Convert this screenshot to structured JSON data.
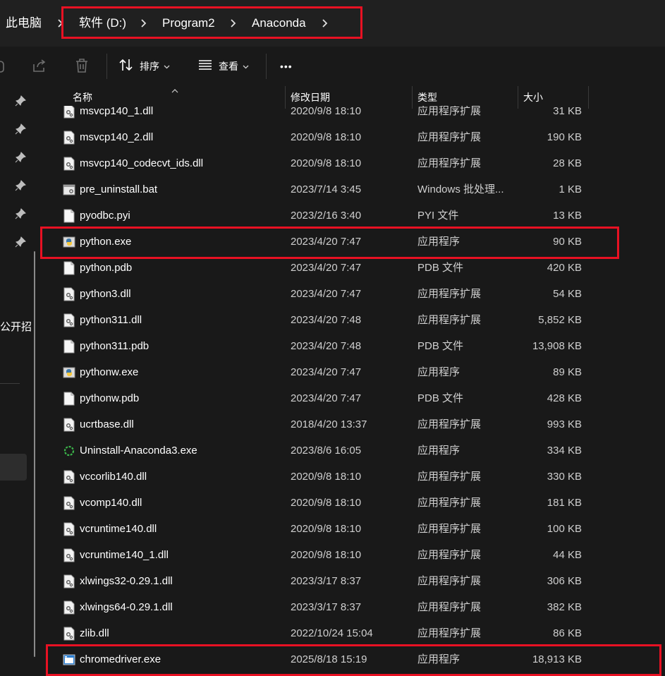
{
  "breadcrumb": {
    "items": [
      "此电脑",
      "软件 (D:)",
      "Program2",
      "Anaconda"
    ]
  },
  "toolbar": {
    "sort_label": "排序",
    "view_label": "查看",
    "more_label": "•••"
  },
  "sidebar": {
    "partial_text": "公开招"
  },
  "columns": {
    "name": "名称",
    "date": "修改日期",
    "type": "类型",
    "size": "大小"
  },
  "files": [
    {
      "name": "msvcp140_1.dll",
      "date": "2020/9/8 18:10",
      "type": "应用程序扩展",
      "size": "31 KB",
      "icon": "dll-file-icon"
    },
    {
      "name": "msvcp140_2.dll",
      "date": "2020/9/8 18:10",
      "type": "应用程序扩展",
      "size": "190 KB",
      "icon": "dll-file-icon"
    },
    {
      "name": "msvcp140_codecvt_ids.dll",
      "date": "2020/9/8 18:10",
      "type": "应用程序扩展",
      "size": "28 KB",
      "icon": "dll-file-icon"
    },
    {
      "name": "pre_uninstall.bat",
      "date": "2023/7/14 3:45",
      "type": "Windows 批处理...",
      "size": "1 KB",
      "icon": "batch-file-icon"
    },
    {
      "name": "pyodbc.pyi",
      "date": "2023/2/16 3:40",
      "type": "PYI 文件",
      "size": "13 KB",
      "icon": "blank-file-icon"
    },
    {
      "name": "python.exe",
      "date": "2023/4/20 7:47",
      "type": "应用程序",
      "size": "90 KB",
      "icon": "python-app-icon"
    },
    {
      "name": "python.pdb",
      "date": "2023/4/20 7:47",
      "type": "PDB 文件",
      "size": "420 KB",
      "icon": "blank-file-icon"
    },
    {
      "name": "python3.dll",
      "date": "2023/4/20 7:47",
      "type": "应用程序扩展",
      "size": "54 KB",
      "icon": "dll-file-icon"
    },
    {
      "name": "python311.dll",
      "date": "2023/4/20 7:48",
      "type": "应用程序扩展",
      "size": "5,852 KB",
      "icon": "dll-file-icon"
    },
    {
      "name": "python311.pdb",
      "date": "2023/4/20 7:48",
      "type": "PDB 文件",
      "size": "13,908 KB",
      "icon": "blank-file-icon"
    },
    {
      "name": "pythonw.exe",
      "date": "2023/4/20 7:47",
      "type": "应用程序",
      "size": "89 KB",
      "icon": "python-app-icon"
    },
    {
      "name": "pythonw.pdb",
      "date": "2023/4/20 7:47",
      "type": "PDB 文件",
      "size": "428 KB",
      "icon": "blank-file-icon"
    },
    {
      "name": "ucrtbase.dll",
      "date": "2018/4/20 13:37",
      "type": "应用程序扩展",
      "size": "993 KB",
      "icon": "dll-file-icon"
    },
    {
      "name": "Uninstall-Anaconda3.exe",
      "date": "2023/8/6 16:05",
      "type": "应用程序",
      "size": "334 KB",
      "icon": "anaconda-uninstall-icon"
    },
    {
      "name": "vccorlib140.dll",
      "date": "2020/9/8 18:10",
      "type": "应用程序扩展",
      "size": "330 KB",
      "icon": "dll-file-icon"
    },
    {
      "name": "vcomp140.dll",
      "date": "2020/9/8 18:10",
      "type": "应用程序扩展",
      "size": "181 KB",
      "icon": "dll-file-icon"
    },
    {
      "name": "vcruntime140.dll",
      "date": "2020/9/8 18:10",
      "type": "应用程序扩展",
      "size": "100 KB",
      "icon": "dll-file-icon"
    },
    {
      "name": "vcruntime140_1.dll",
      "date": "2020/9/8 18:10",
      "type": "应用程序扩展",
      "size": "44 KB",
      "icon": "dll-file-icon"
    },
    {
      "name": "xlwings32-0.29.1.dll",
      "date": "2023/3/17 8:37",
      "type": "应用程序扩展",
      "size": "306 KB",
      "icon": "dll-file-icon"
    },
    {
      "name": "xlwings64-0.29.1.dll",
      "date": "2023/3/17 8:37",
      "type": "应用程序扩展",
      "size": "382 KB",
      "icon": "dll-file-icon"
    },
    {
      "name": "zlib.dll",
      "date": "2022/10/24 15:04",
      "type": "应用程序扩展",
      "size": "86 KB",
      "icon": "dll-file-icon"
    },
    {
      "name": "chromedriver.exe",
      "date": "2025/8/18 15:19",
      "type": "应用程序",
      "size": "18,913 KB",
      "icon": "exe-window-icon"
    }
  ],
  "highlights": [
    "breadcrumb",
    "python.exe",
    "chromedriver.exe"
  ],
  "colors": {
    "highlight": "#e81123",
    "background": "#191919",
    "address_bar": "#202020"
  }
}
